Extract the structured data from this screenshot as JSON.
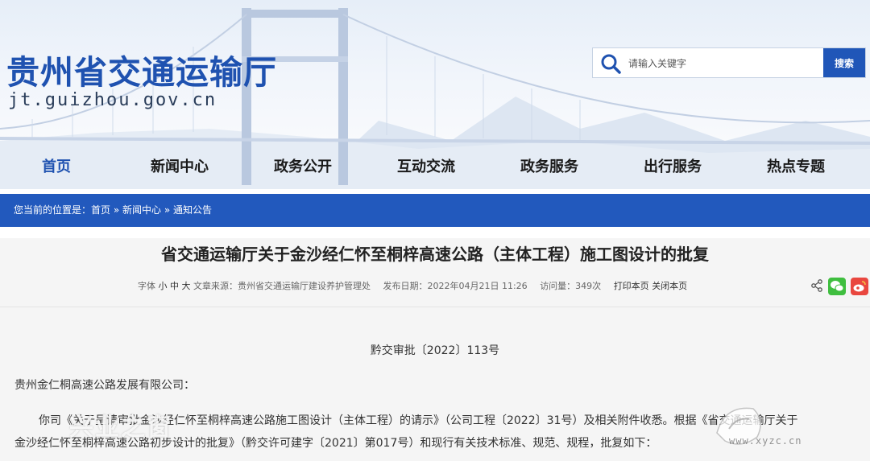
{
  "header": {
    "site_title": "贵州省交通运输厅",
    "site_domain": "jt.guizhou.gov.cn",
    "search": {
      "placeholder": "请输入关键字",
      "button_label": "搜索"
    }
  },
  "nav": {
    "items": [
      {
        "label": "首页",
        "active": true
      },
      {
        "label": "新闻中心"
      },
      {
        "label": "政务公开"
      },
      {
        "label": "互动交流"
      },
      {
        "label": "政务服务"
      },
      {
        "label": "出行服务"
      },
      {
        "label": "热点专题"
      }
    ]
  },
  "breadcrumb": {
    "prefix": "您当前的位置是：",
    "items": [
      "首页",
      "新闻中心",
      "通知公告"
    ],
    "separator": " » "
  },
  "article": {
    "title": "省交通运输厅关于金沙经仁怀至桐梓高速公路（主体工程）施工图设计的批复",
    "meta": {
      "font_label": "字体",
      "sizes": [
        "小",
        "中",
        "大"
      ],
      "source": "文章来源：贵州省交通运输厅建设养护管理处",
      "date": "发布日期：2022年04月21日 11:26",
      "views": "访问量：349次",
      "print": "打印本页",
      "close": "关闭本页"
    },
    "doc_number": "黔交审批〔2022〕113号",
    "recipient": "贵州金仁桐高速公路发展有限公司：",
    "body_line1": "你司《关于呈请审批金沙经仁怀至桐梓高速公路施工图设计（主体工程）的请示》（公司工程〔2022〕31号）及相关附件收悉。根据《省交通运输厅关于",
    "body_line2": "金沙经仁怀至桐梓高速公路初步设计的批复》（黔交许可建字〔2021〕第017号）和现行有关技术标准、规范、规程，批复如下："
  },
  "watermark": {
    "text": "兴业之窗",
    "url": "www.xyzc.cn"
  },
  "colors": {
    "brand_blue": "#1f52b0",
    "bar_blue": "#2259bd",
    "wechat_green": "#3fbe3f",
    "weibo_red": "#e9473f"
  }
}
